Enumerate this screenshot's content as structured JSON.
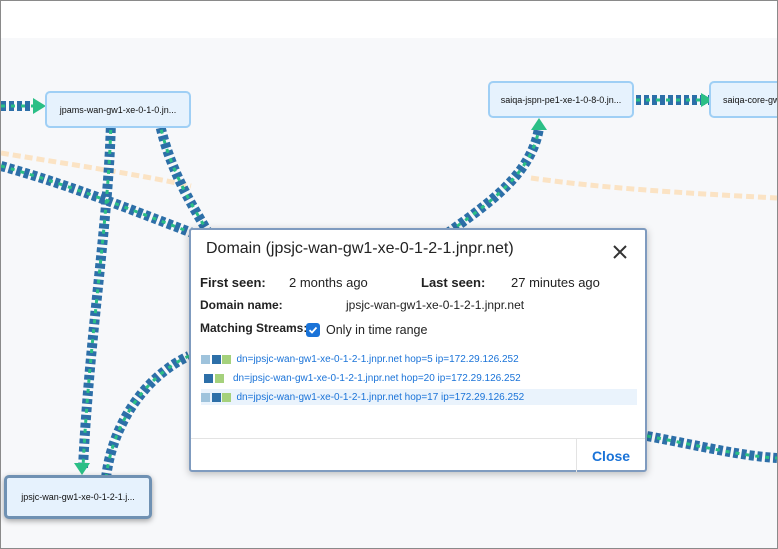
{
  "topology": {
    "nodes": [
      {
        "label": "jpams-wan-gw1-xe-0-1-0.jn..."
      },
      {
        "label": "saiqa-jspn-pe1-xe-1-0-8-0.jn..."
      },
      {
        "label": "saiqa-core-gw"
      },
      {
        "label": "jpsjc-wan-gw1-xe-0-1-2-1.j..."
      }
    ]
  },
  "dialog": {
    "title": "Domain (jpsjc-wan-gw1-xe-0-1-2-1.jnpr.net)",
    "first_seen_label": "First seen:",
    "first_seen_value": "2 months ago",
    "last_seen_label": "Last seen:",
    "last_seen_value": "27 minutes ago",
    "domain_name_label": "Domain name:",
    "domain_name_value": "jpsjc-wan-gw1-xe-0-1-2-1.jnpr.net",
    "matching_streams_label": "Matching Streams:",
    "only_in_time_range_label": "Only in time range",
    "only_in_time_range_checked": true,
    "streams": [
      {
        "text": "dn=jpsjc-wan-gw1-xe-0-1-2-1.jnpr.net hop=5 ip=172.29.126.252",
        "colors": [
          "#9fc3dc",
          "#2d6fa8",
          "#a5d17c"
        ]
      },
      {
        "text": "dn=jpsjc-wan-gw1-xe-0-1-2-1.jnpr.net hop=20 ip=172.29.126.252",
        "colors": [
          "#2d6fa8",
          "#a5d17c"
        ]
      },
      {
        "text": "dn=jpsjc-wan-gw1-xe-0-1-2-1.jnpr.net hop=17 ip=172.29.126.252",
        "colors": [
          "#9fc3dc",
          "#2d6fa8",
          "#a5d17c"
        ]
      }
    ],
    "close_label": "Close"
  },
  "colors": {
    "link_blue": "#2d6fa8",
    "link_green": "#2bbf86",
    "link_peach": "#fbe3c4",
    "accent": "#1a73d8"
  }
}
